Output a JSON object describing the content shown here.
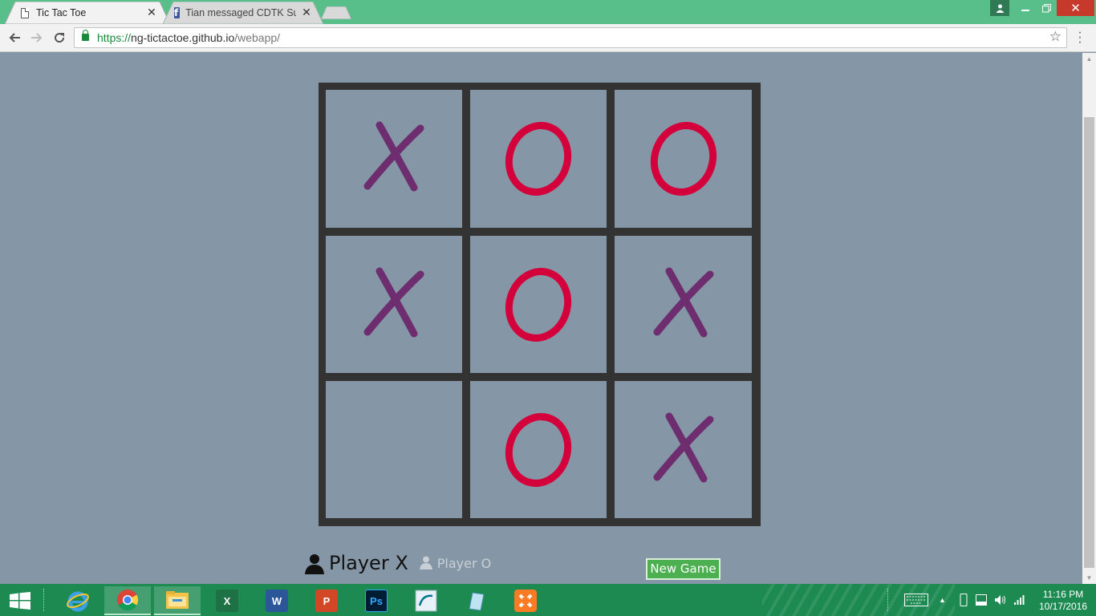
{
  "browser": {
    "tabs": [
      {
        "title": "Tic Tac Toe",
        "active": true
      },
      {
        "title": "Tian messaged CDTK Sul",
        "active": false
      }
    ],
    "url_scheme": "https://",
    "url_host": "ng-tictactoe.github.io",
    "url_path": "/webapp/"
  },
  "game": {
    "board": [
      [
        "X",
        "O",
        "O"
      ],
      [
        "X",
        "O",
        "X"
      ],
      [
        "",
        "O",
        "X"
      ]
    ],
    "x_color": "#6d2d6e",
    "o_color": "#d3003c",
    "player_x_label": "Player X",
    "player_o_label": "Player O",
    "current_player": "X",
    "new_game_label": "New Game"
  },
  "taskbar": {
    "apps": [
      {
        "name": "internet-explorer-icon"
      },
      {
        "name": "chrome-icon",
        "active": true
      },
      {
        "name": "file-explorer-icon",
        "active": true
      },
      {
        "name": "excel-icon",
        "letter": "X"
      },
      {
        "name": "word-icon",
        "letter": "W"
      },
      {
        "name": "powerpoint-icon",
        "letter": "P"
      },
      {
        "name": "photoshop-icon",
        "letter": "Ps"
      },
      {
        "name": "mysql-installer-icon"
      },
      {
        "name": "notepad-icon"
      },
      {
        "name": "xampp-icon"
      }
    ],
    "time": "11:16 PM",
    "date": "10/17/2016"
  }
}
